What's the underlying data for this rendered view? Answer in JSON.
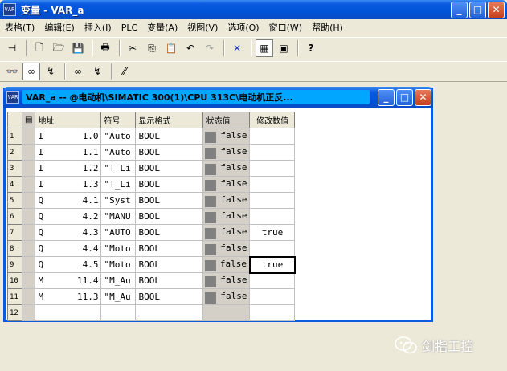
{
  "app": {
    "title": "变量 - VAR_a",
    "icon_text": "VAR"
  },
  "window_buttons": {
    "minimize": "_",
    "maximize": "□",
    "close": "✕"
  },
  "menu": [
    "表格(T)",
    "编辑(E)",
    "插入(I)",
    "PLC",
    "变量(A)",
    "视图(V)",
    "选项(O)",
    "窗口(W)",
    "帮助(H)"
  ],
  "toolbar1": [
    {
      "name": "pin-icon",
      "glyph": "⊣"
    },
    {
      "name": "new-icon",
      "glyph": "🗋"
    },
    {
      "name": "open-icon",
      "glyph": "🗁"
    },
    {
      "name": "save-icon",
      "glyph": "💾"
    },
    {
      "name": "print-icon",
      "glyph": "🖶"
    },
    {
      "name": "cut-icon",
      "glyph": "✂"
    },
    {
      "name": "copy-icon",
      "glyph": "⎘"
    },
    {
      "name": "paste-icon",
      "glyph": "📋"
    },
    {
      "name": "undo-icon",
      "glyph": "↶"
    },
    {
      "name": "redo-icon",
      "glyph": "↷"
    },
    {
      "name": "delete-icon",
      "glyph": "✕"
    },
    {
      "name": "network-icon",
      "glyph": "▦"
    },
    {
      "name": "download-icon",
      "glyph": "▣"
    },
    {
      "name": "help-icon",
      "glyph": "?"
    }
  ],
  "toolbar2": [
    {
      "name": "monitor-icon",
      "glyph": "👓"
    },
    {
      "name": "monitor-variables-icon",
      "glyph": "∞"
    },
    {
      "name": "modify-icon",
      "glyph": "↯"
    },
    {
      "name": "update-icon",
      "glyph": "∞"
    },
    {
      "name": "activate-icon",
      "glyph": "↯"
    },
    {
      "name": "force-icon",
      "glyph": "⁄⁄"
    }
  ],
  "child_window": {
    "title": "VAR_a -- @电动机\\SIMATIC 300(1)\\CPU 313C\\电动机正反..."
  },
  "table": {
    "headers": {
      "address": "地址",
      "symbol": "符号",
      "format": "显示格式",
      "status": "状态值",
      "modify": "修改数值"
    },
    "rows": [
      {
        "num": "1",
        "area": "I",
        "offset": "1.0",
        "symbol": "\"Auto",
        "format": "BOOL",
        "status": "false",
        "modify": ""
      },
      {
        "num": "2",
        "area": "I",
        "offset": "1.1",
        "symbol": "\"Auto",
        "format": "BOOL",
        "status": "false",
        "modify": ""
      },
      {
        "num": "3",
        "area": "I",
        "offset": "1.2",
        "symbol": "\"T_Li",
        "format": "BOOL",
        "status": "false",
        "modify": ""
      },
      {
        "num": "4",
        "area": "I",
        "offset": "1.3",
        "symbol": "\"T_Li",
        "format": "BOOL",
        "status": "false",
        "modify": ""
      },
      {
        "num": "5",
        "area": "Q",
        "offset": "4.1",
        "symbol": "\"Syst",
        "format": "BOOL",
        "status": "false",
        "modify": ""
      },
      {
        "num": "6",
        "area": "Q",
        "offset": "4.2",
        "symbol": "\"MANU",
        "format": "BOOL",
        "status": "false",
        "modify": ""
      },
      {
        "num": "7",
        "area": "Q",
        "offset": "4.3",
        "symbol": "\"AUTO",
        "format": "BOOL",
        "status": "false",
        "modify": "true"
      },
      {
        "num": "8",
        "area": "Q",
        "offset": "4.4",
        "symbol": "\"Moto",
        "format": "BOOL",
        "status": "false",
        "modify": ""
      },
      {
        "num": "9",
        "area": "Q",
        "offset": "4.5",
        "symbol": "\"Moto",
        "format": "BOOL",
        "status": "false",
        "modify": "true"
      },
      {
        "num": "10",
        "area": "M",
        "offset": "11.4",
        "symbol": "\"M_Au",
        "format": "BOOL",
        "status": "false",
        "modify": ""
      },
      {
        "num": "11",
        "area": "M",
        "offset": "11.3",
        "symbol": "\"M_Au",
        "format": "BOOL",
        "status": "false",
        "modify": ""
      },
      {
        "num": "12",
        "area": "",
        "offset": "",
        "symbol": "",
        "format": "",
        "status": "",
        "modify": ""
      }
    ],
    "focused_row": "9"
  },
  "watermark": {
    "text": "剑指工控"
  }
}
